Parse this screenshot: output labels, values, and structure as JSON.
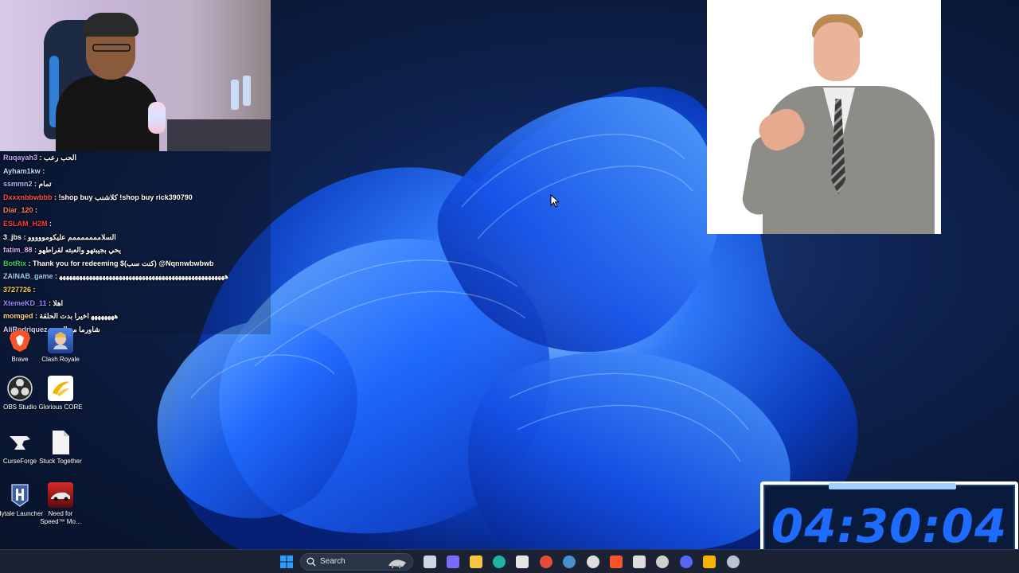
{
  "chat": {
    "messages": [
      {
        "user": "Ruqayah3",
        "user_color": "#c9a7ff",
        "text": "الحب رعب"
      },
      {
        "user": "Ayham1kw",
        "user_color": "#b6e1ff",
        "text": ""
      },
      {
        "user": "ssmmn2",
        "user_color": "#b4b4ff",
        "text": "تمام"
      },
      {
        "user": "Dxxxnbbwbbb",
        "user_color": "#ff4d4d",
        "text": "!shop buy كلاشنب !shop buy rick390790"
      },
      {
        "user": "Diar_120",
        "user_color": "#ff7a5c",
        "text": ""
      },
      {
        "user": "ESLAM_H2M",
        "user_color": "#ff3b3b",
        "text": ""
      },
      {
        "user": "3_jbs",
        "user_color": "#ffffff",
        "text": "السلامممممممم عليكومووووو"
      },
      {
        "user": "fatim_88",
        "user_color": "#d9b3ff",
        "text": "يحي بجيبتهو والعبته لقراطهو"
      },
      {
        "user": "BotRix",
        "user_color": "#3bd16f",
        "text": "Thank you for redeeming $(كنت سب) @Nqnnwbwbwb"
      },
      {
        "user": "ZAINAB_game",
        "user_color": "#9ad0ff",
        "text": "ﻫﻬﻬﻬﻬﻬﻬﻬﻬﻬﻬﻬﻬﻬﻬﻬﻬﻬﻬﻬﻬﻬﻬﻬﻬﻬﻬﻬﻬﻬﻬﻬﻬﻬﻬﻬﻬﻬﻬﻬﻬﻬﻬﻬﻬﻬﻬﻬﻬﻬﻬ"
      },
      {
        "user": "3727726",
        "user_color": "#ffd45c",
        "text": ""
      },
      {
        "user": "XtemeKD_11",
        "user_color": "#9b8bff",
        "text": "اهلا"
      },
      {
        "user": "momged",
        "user_color": "#ffd08a",
        "text": "ﻫﻬﻬﻬﻬﻬﻬﻬ اخيرا بدت الحلقة"
      },
      {
        "user": "AliRodriquez",
        "user_color": "#d0d0ff",
        "text": "شاورما مع العبد"
      }
    ]
  },
  "desktop_icons": [
    {
      "label": "Brave",
      "color": "#fb542b",
      "icon": "brave-icon"
    },
    {
      "label": "Clash Royale",
      "color": "#3a6fd0",
      "icon": "clash-royale-icon"
    },
    {
      "label": "OBS Studio",
      "color": "#2a2a2a",
      "icon": "obs-icon"
    },
    {
      "label": "Glorious CORE",
      "color": "#f5b400",
      "icon": "glorious-icon"
    },
    {
      "label": "CurseForge",
      "color": "#111111",
      "icon": "curseforge-icon"
    },
    {
      "label": "Stuck Together",
      "color": "#f2f2f2",
      "icon": "file-icon"
    },
    {
      "label": "Hytale Launcher",
      "color": "#3b5fa8",
      "icon": "hytale-icon"
    },
    {
      "label": "Need for Speed™ Mo...",
      "color": "#b01818",
      "icon": "nfs-icon"
    }
  ],
  "timer": {
    "value": "04:30:04"
  },
  "taskbar": {
    "search_placeholder": "Search",
    "apps": [
      {
        "name": "start",
        "icon": "windows-icon",
        "color": "#2e9bff"
      },
      {
        "name": "task-view",
        "icon": "task-view-icon",
        "color": "#cfd6e0"
      },
      {
        "name": "copilot",
        "icon": "copilot-icon",
        "color": "#7a6cff"
      },
      {
        "name": "file-explorer",
        "icon": "folder-icon",
        "color": "#f5c542"
      },
      {
        "name": "edge",
        "icon": "edge-icon",
        "color": "#1fb3a6"
      },
      {
        "name": "store",
        "icon": "store-icon",
        "color": "#e6e6e6"
      },
      {
        "name": "chrome",
        "icon": "chrome-icon",
        "color": "#e84b3c"
      },
      {
        "name": "steam",
        "icon": "steam-icon",
        "color": "#4a8fd0"
      },
      {
        "name": "obs",
        "icon": "obs-icon",
        "color": "#dddddd"
      },
      {
        "name": "brave",
        "icon": "brave-icon",
        "color": "#fb542b"
      },
      {
        "name": "curseforge",
        "icon": "curseforge-icon",
        "color": "#dddddd"
      },
      {
        "name": "chatgpt",
        "icon": "chatgpt-icon",
        "color": "#cfcfcf"
      },
      {
        "name": "discord",
        "icon": "discord-icon",
        "color": "#5865f2"
      },
      {
        "name": "glorious",
        "icon": "glorious-icon",
        "color": "#f5b400"
      },
      {
        "name": "settings",
        "icon": "gear-icon",
        "color": "#b9c3d3"
      }
    ]
  }
}
